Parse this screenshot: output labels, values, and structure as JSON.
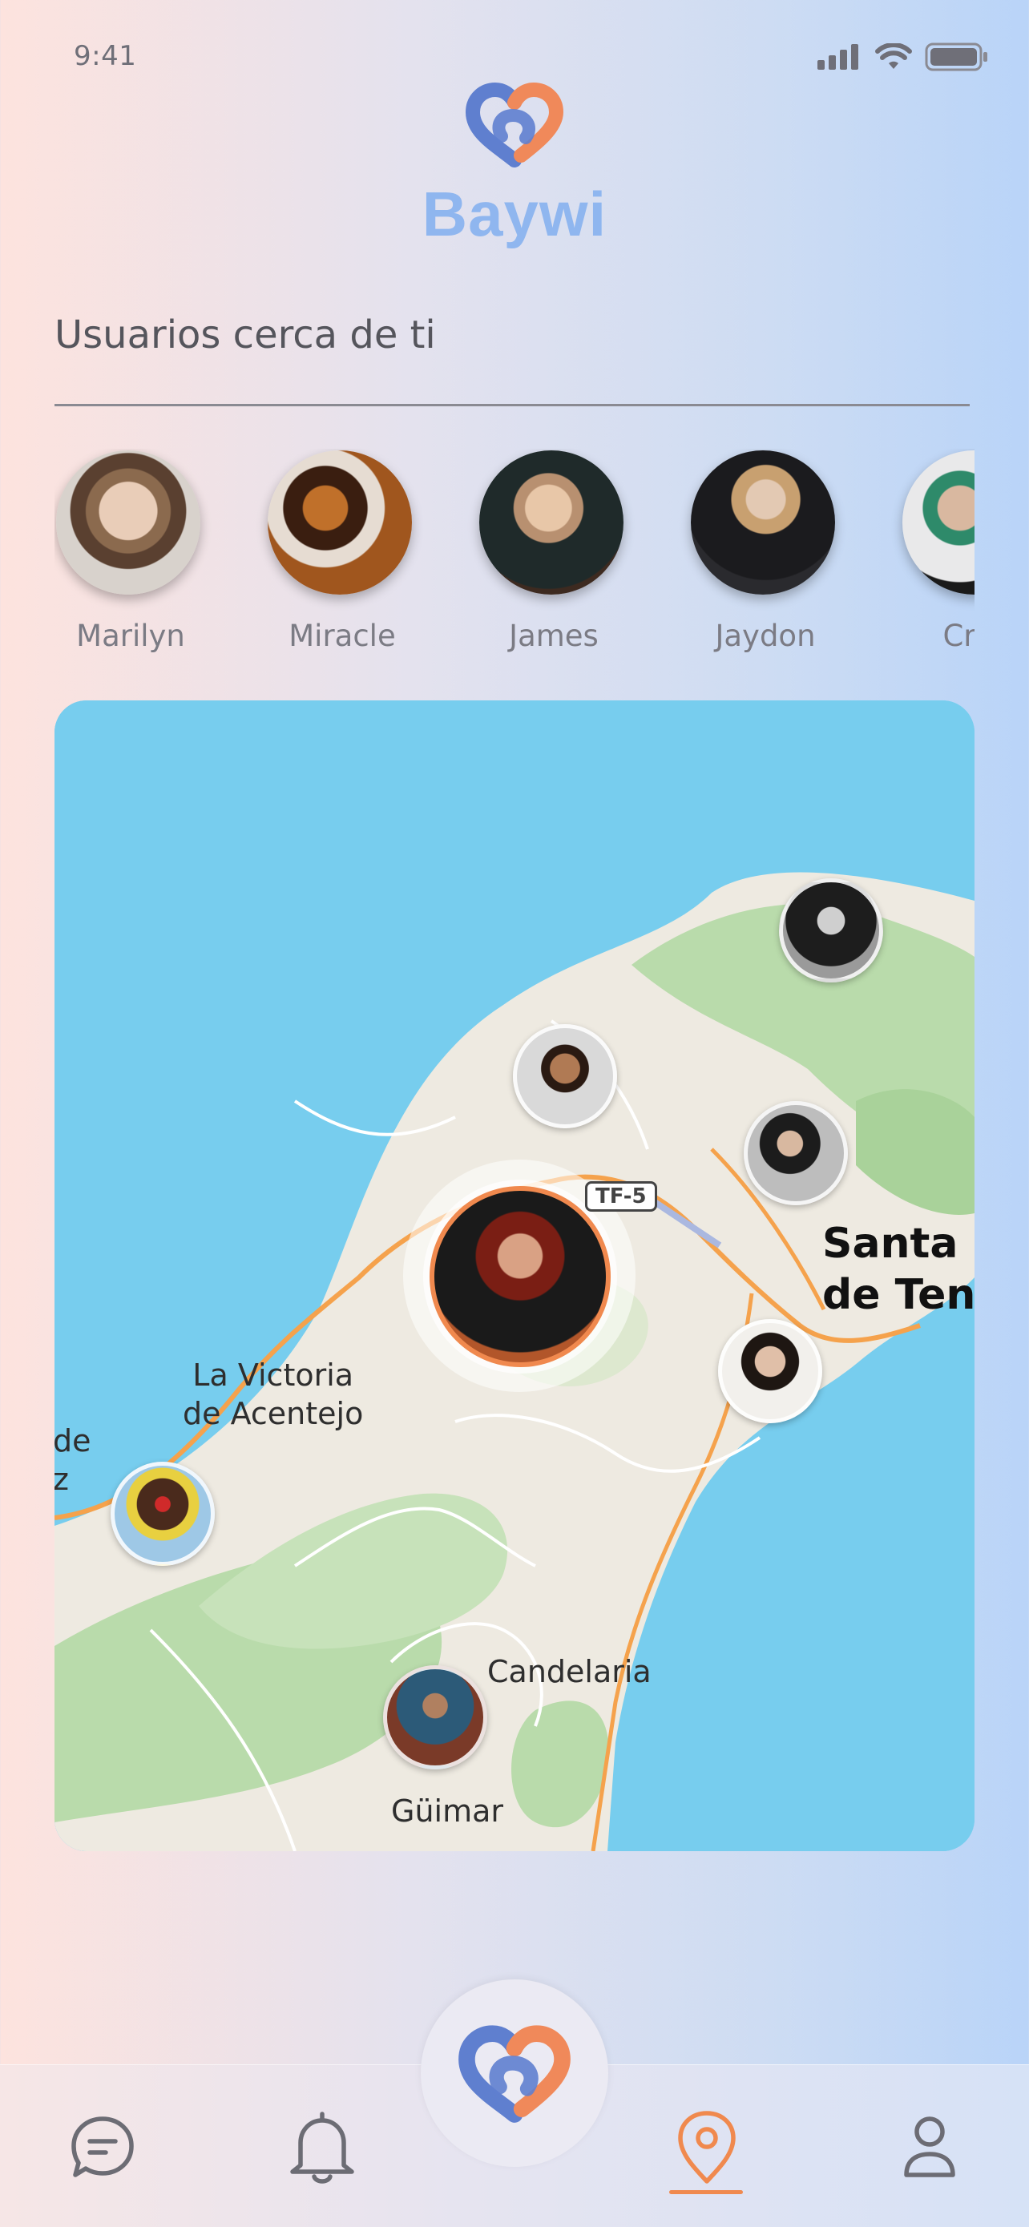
{
  "status_bar": {
    "time": "9:41"
  },
  "header": {
    "brand": "Baywi",
    "logo_icon": "heart-link-logo"
  },
  "nearby": {
    "title": "Usuarios cerca de ti",
    "users": [
      {
        "name": "Marilyn"
      },
      {
        "name": "Miracle"
      },
      {
        "name": "James"
      },
      {
        "name": "Jaydon"
      },
      {
        "name": "Crist"
      }
    ]
  },
  "map": {
    "road_badge": "TF-5",
    "places": {
      "la_victoria_line1": "La Victoria",
      "la_victoria_line2": "de Acentejo",
      "santa_cruz_line1": "Santa C",
      "santa_cruz_line2": "de Tene",
      "candelaria": "Candelaria",
      "guimar": "Güimar",
      "partial_left_line1": "de",
      "partial_left_line2": "z"
    },
    "colors": {
      "sea": "#77cdee",
      "land": "#eeeae1",
      "forest": "#b9dbab",
      "road": "#f5a24c"
    }
  },
  "nav": {
    "items": [
      {
        "icon": "chat-icon",
        "active": false
      },
      {
        "icon": "bell-icon",
        "active": false
      },
      {
        "icon": "heart-link-logo",
        "active": false
      },
      {
        "icon": "location-pin-icon",
        "active": true
      },
      {
        "icon": "profile-icon",
        "active": false
      }
    ],
    "active_color": "#f0894e"
  }
}
